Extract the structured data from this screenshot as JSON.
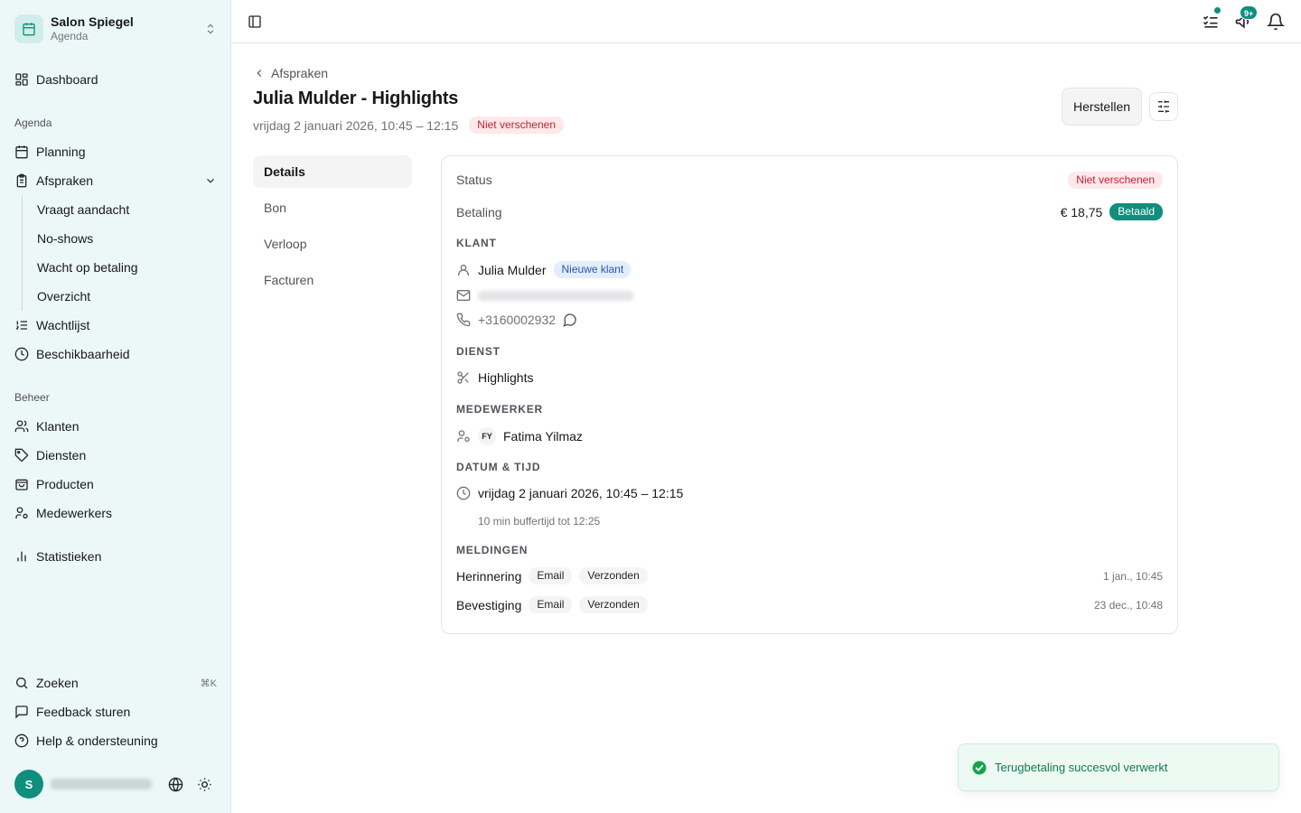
{
  "org": {
    "name": "Salon Spiegel",
    "subtitle": "Agenda"
  },
  "nav": {
    "dashboard": "Dashboard",
    "agenda_label": "Agenda",
    "planning": "Planning",
    "afspraken": "Afspraken",
    "sub": [
      "Vraagt aandacht",
      "No-shows",
      "Wacht op betaling",
      "Overzicht"
    ],
    "wachtlijst": "Wachtlijst",
    "beschikbaarheid": "Beschikbaarheid",
    "beheer_label": "Beheer",
    "klanten": "Klanten",
    "diensten": "Diensten",
    "producten": "Producten",
    "medewerkers": "Medewerkers",
    "statistieken": "Statistieken",
    "zoeken": "Zoeken",
    "zoeken_shortcut": "⌘K",
    "feedback": "Feedback sturen",
    "help": "Help & ondersteuning",
    "user_initial": "S"
  },
  "topbar": {
    "notif_badge": "9+"
  },
  "header": {
    "breadcrumb": "Afspraken",
    "title": "Julia Mulder - Highlights",
    "datetime": "vrijdag 2 januari 2026, 10:45 – 12:15",
    "status_badge": "Niet verschenen",
    "restore_button": "Herstellen"
  },
  "tabs": [
    "Details",
    "Bon",
    "Verloop",
    "Facturen"
  ],
  "details": {
    "status_label": "Status",
    "status_value": "Niet verschenen",
    "payment_label": "Betaling",
    "payment_amount": "€ 18,75",
    "payment_status": "Betaald",
    "client_heading": "KLANT",
    "client_name": "Julia Mulder",
    "client_badge": "Nieuwe klant",
    "client_phone": "+3160002932",
    "service_heading": "DIENST",
    "service_name": "Highlights",
    "staff_heading": "MEDEWERKER",
    "staff_initials": "FY",
    "staff_name": "Fatima Yilmaz",
    "datetime_heading": "DATUM & TIJD",
    "datetime_value": "vrijdag 2 januari 2026, 10:45 – 12:15",
    "buffer_note": "10 min buffertijd tot 12:25",
    "notifications_heading": "MELDINGEN",
    "notifications": [
      {
        "type": "Herinnering",
        "channel": "Email",
        "state": "Verzonden",
        "time": "1 jan., 10:45"
      },
      {
        "type": "Bevestiging",
        "channel": "Email",
        "state": "Verzonden",
        "time": "23 dec., 10:48"
      }
    ]
  },
  "toast": {
    "message": "Terugbetaling succesvol verwerkt"
  },
  "colors": {
    "accent": "#0f8f7e",
    "danger": "#c42130",
    "sidebar_bg": "#ecf8f8"
  }
}
